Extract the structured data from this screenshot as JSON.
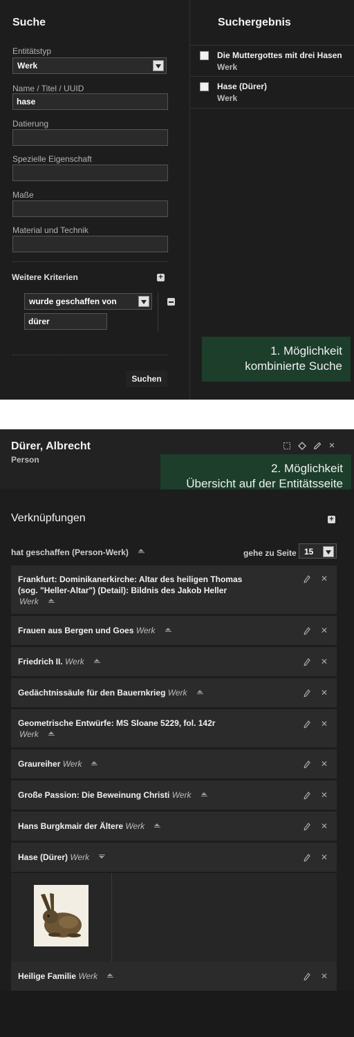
{
  "search": {
    "title": "Suche",
    "fields": {
      "entity_type": {
        "label": "Entitätstyp",
        "value": "Werk"
      },
      "name": {
        "label": "Name / Titel / UUID",
        "value": "hase"
      },
      "dating": {
        "label": "Datierung",
        "value": ""
      },
      "special_property": {
        "label": "Spezielle Eigenschaft",
        "value": ""
      },
      "dimensions": {
        "label": "Maße",
        "value": ""
      },
      "material": {
        "label": "Material und Technik",
        "value": ""
      }
    },
    "criteria": {
      "title": "Weitere Kriterien",
      "relation": "wurde geschaffen von",
      "value": "dürer"
    },
    "submit_label": "Suchen"
  },
  "results": {
    "title": "Suchergebnis",
    "items": [
      {
        "title": "Die Muttergottes mit drei Hasen",
        "type": "Werk"
      },
      {
        "title": "Hase (Dürer)",
        "type": "Werk"
      }
    ]
  },
  "callout1": {
    "line1": "1. Möglichkeit",
    "line2": "kombinierte Suche"
  },
  "entity": {
    "name": "Dürer, Albrecht",
    "type": "Person",
    "icons": [
      "select-icon",
      "crosshair-icon",
      "pencil-icon",
      "close-icon"
    ]
  },
  "callout2": {
    "line1": "2. Möglichkeit",
    "line2": "Übersicht auf der Entitätsseite"
  },
  "links": {
    "title": "Verknüpfungen",
    "relation": "hat geschaffen (Person-Werk)",
    "goto_label": "gehe zu Seite",
    "goto_value": "15",
    "items": [
      {
        "line1": "Frankfurt: Dominikanerkirche: Altar des heiligen Thomas",
        "line2": "(sog. \"Heller-Altar\") (Detail): Bildnis des Jakob Heller",
        "type": "Werk"
      },
      {
        "title": "Frauen aus Bergen und Goes",
        "type": "Werk"
      },
      {
        "title": "Friedrich II.",
        "type": "Werk"
      },
      {
        "title": "Gedächtnissäule für den Bauernkrieg",
        "type": "Werk"
      },
      {
        "title": "Geometrische Entwürfe: MS Sloane 5229, fol. 142r",
        "type": "Werk"
      },
      {
        "title": "Graureiher",
        "type": "Werk"
      },
      {
        "title": "Große Passion: Die Beweinung Christi",
        "type": "Werk"
      },
      {
        "title": "Hans Burgkmair der Ältere",
        "type": "Werk"
      },
      {
        "title": "Hase (Dürer)",
        "type": "Werk"
      },
      {
        "title": "Heilige Familie",
        "type": "Werk"
      }
    ]
  },
  "colors": {
    "background": "#1d1d1d",
    "row": "#2b2b2b",
    "callout": "#1c3e2a"
  }
}
